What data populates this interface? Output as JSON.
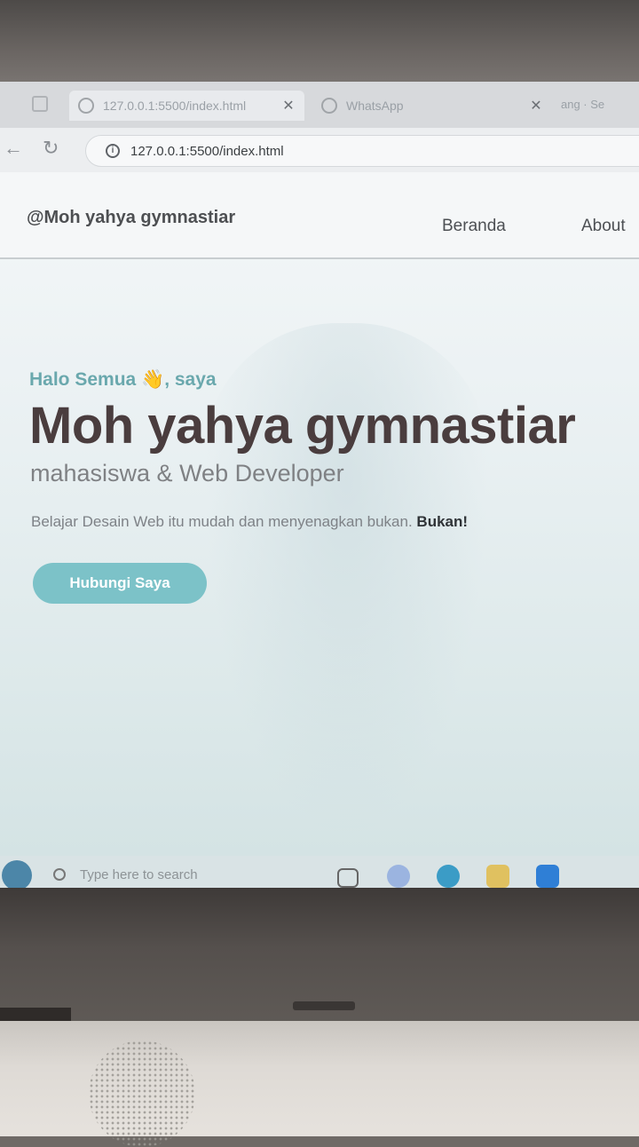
{
  "browser": {
    "active_tab_title": "127.0.0.1:5500/index.html",
    "other_tab_title": "WhatsApp",
    "tab_extra": "ang · Se",
    "url": "127.0.0.1:5500/index.html"
  },
  "site": {
    "brand": "@Moh yahya gymnastiar",
    "nav": [
      "Beranda",
      "About"
    ],
    "greeting": "Halo Semua 👋, saya",
    "name": "Moh yahya gymnastiar",
    "role": "mahasiswa & Web Developer",
    "tagline_prefix": "Belajar Desain Web itu mudah dan menyenagkan bukan.",
    "tagline_emphasis": "Bukan!",
    "cta_label": "Hubungi Saya"
  },
  "taskbar": {
    "search_placeholder": "Type here to search"
  },
  "colors": {
    "accent": "#7cc2c8",
    "greeting": "#6aa8ad",
    "name": "#4a3d3e"
  },
  "icons": [
    "reload-icon",
    "info-icon",
    "search-icon",
    "start-icon",
    "close-icon"
  ]
}
